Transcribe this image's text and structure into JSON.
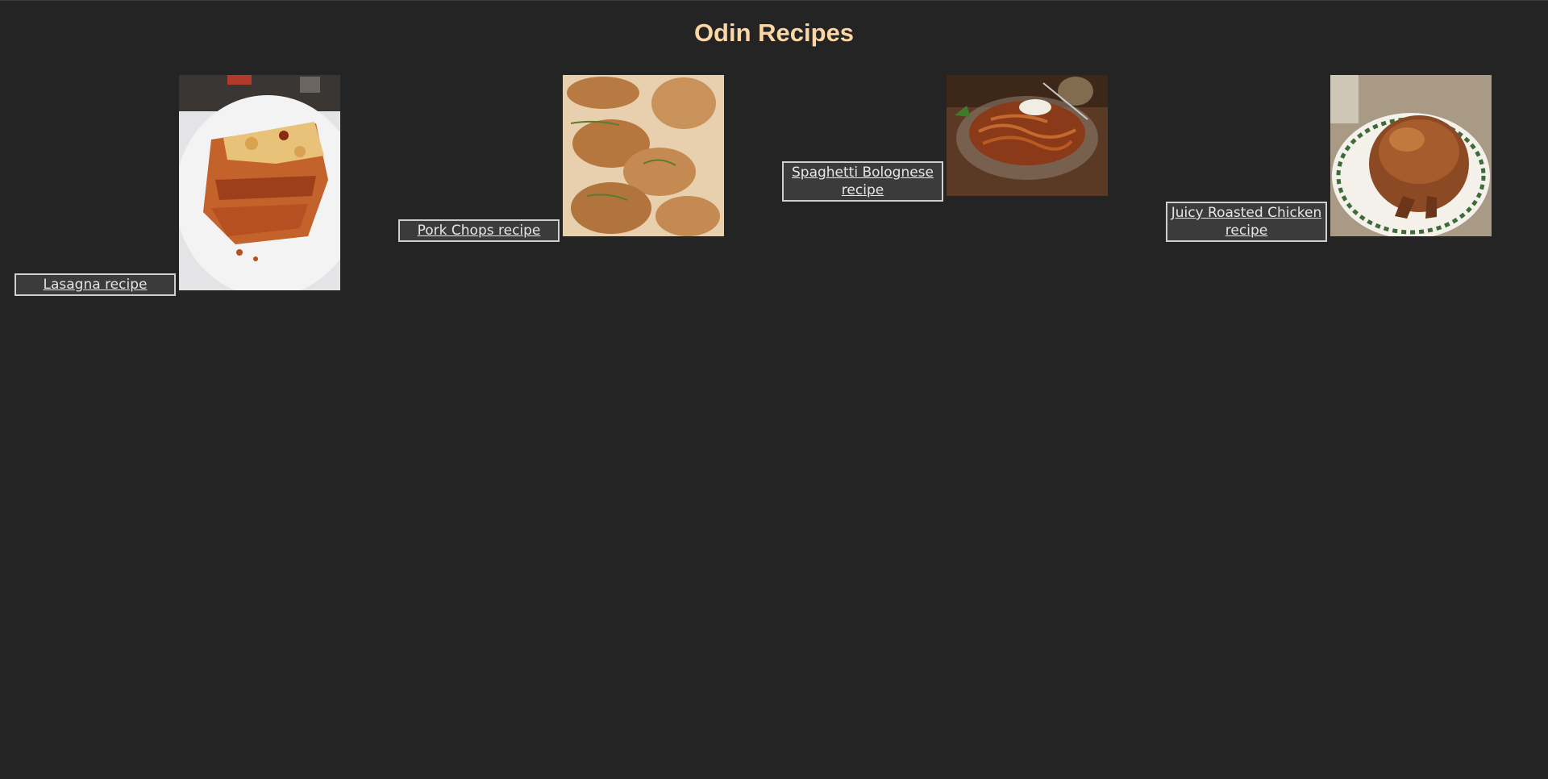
{
  "header": {
    "title": "Odin Recipes",
    "title_color": "#fcd7a5",
    "background": "#242424"
  },
  "recipes": [
    {
      "link_label": "Lasagna recipe",
      "photo": "lasagna-photo"
    },
    {
      "link_label": "Pork Chops recipe",
      "photo": "pork-chops-photo"
    },
    {
      "link_label": "Spaghetti Bolognese recipe",
      "photo": "spaghetti-bolognese-photo"
    },
    {
      "link_label": "Juicy Roasted Chicken recipe",
      "photo": "roasted-chicken-photo"
    }
  ]
}
